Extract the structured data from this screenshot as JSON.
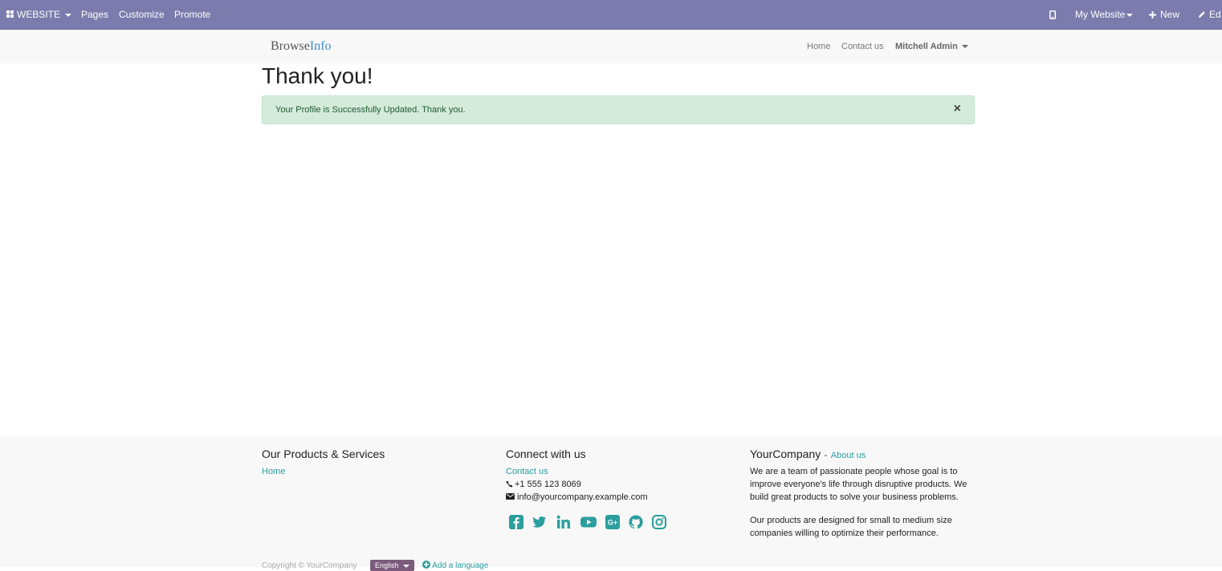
{
  "admin_bar": {
    "website_label": "WEBSITE",
    "pages_label": "Pages",
    "customize_label": "Customize",
    "promote_label": "Promote",
    "my_website_label": "My Website",
    "new_label": "New",
    "edit_label": "Ed"
  },
  "header": {
    "brand_part1": "Browse",
    "brand_part2": "Info",
    "nav_home": "Home",
    "nav_contact": "Contact us",
    "user_name": "Mitchell Admin"
  },
  "main": {
    "title": "Thank you!",
    "alert_message": "Your Profile is Successfully Updated. Thank you.",
    "alert_close": "×"
  },
  "footer": {
    "col1": {
      "heading": "Our Products & Services",
      "home_link": "Home"
    },
    "col2": {
      "heading": "Connect with us",
      "contact_link": "Contact us",
      "phone": "+1 555 123 8069",
      "email": "info@yourcompany.example.com",
      "social_icons": [
        "facebook-icon",
        "twitter-icon",
        "linkedin-icon",
        "youtube-icon",
        "google-plus-icon",
        "github-icon",
        "instagram-icon"
      ]
    },
    "col3": {
      "company": "YourCompany",
      "separator": "-",
      "about_link": "About us",
      "para1": "We are a team of passionate people whose goal is to improve everyone's life through disruptive products. We build great products to solve your business problems.",
      "para2": "Our products are designed for small to medium size companies willing to optimize their performance."
    },
    "copyright": "Copyright © YourCompany",
    "language": "English",
    "add_language": "Add a language"
  },
  "colors": {
    "admin_bar_bg": "#7c7bad",
    "link_teal": "#2b9e9e",
    "alert_bg": "#d4ebdb",
    "brand_blue": "#3b8dc7"
  }
}
